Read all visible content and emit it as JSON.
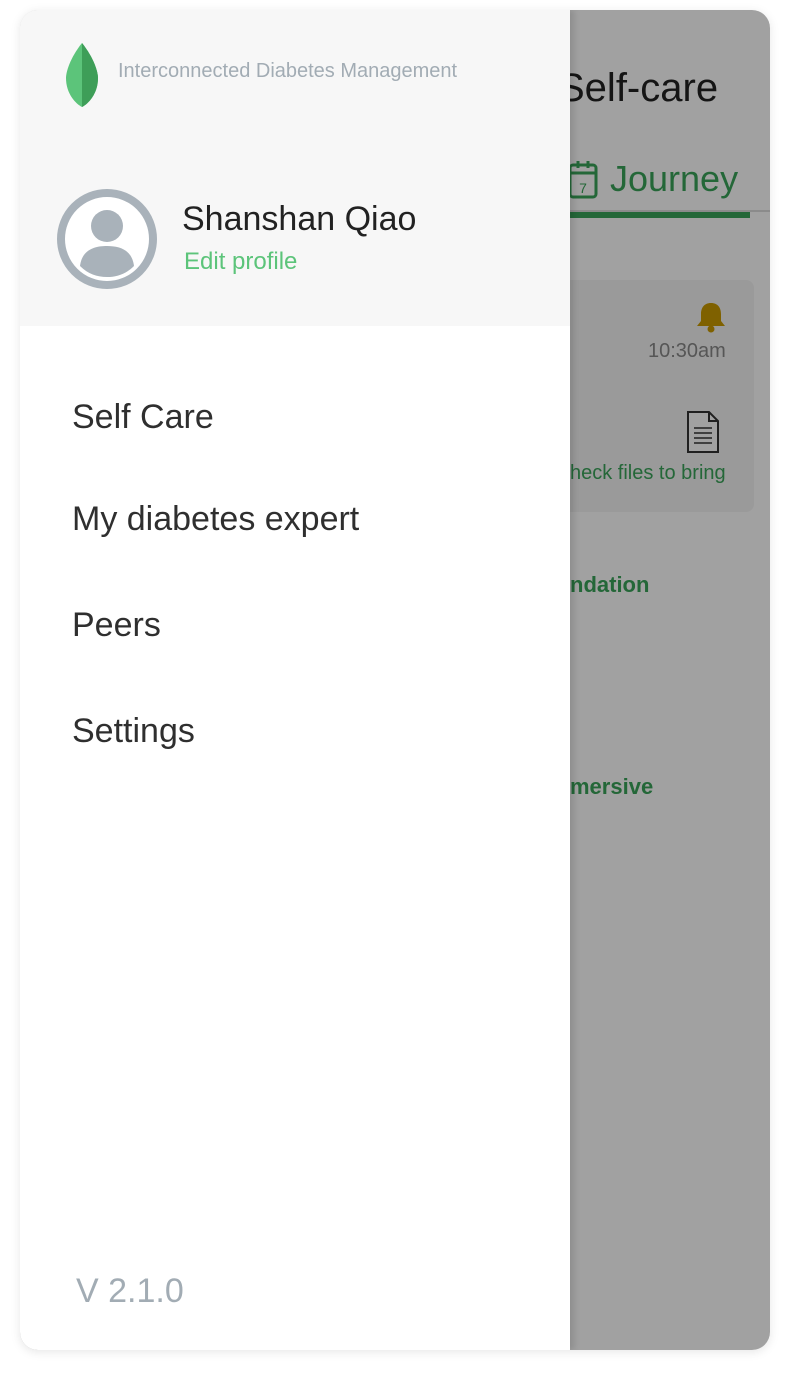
{
  "background": {
    "title": "Self-care",
    "active_tab": "Journey",
    "reminder_time": "10:30am",
    "files_link": "heck files to bring",
    "link_1": "ndation",
    "link_2": "mersive",
    "icons": [
      "calendar-icon",
      "bell-icon",
      "document-icon"
    ],
    "colors": {
      "accent": "#3aa35a",
      "bell": "#c99a00"
    }
  },
  "drawer": {
    "app_name": "Interconnected Diabetes Management",
    "logo_icon": "leaf-icon",
    "user": {
      "name": "Shanshan Qiao",
      "edit_label": "Edit profile",
      "avatar_icon": "user-avatar-icon"
    },
    "menu": [
      {
        "label": "Self Care"
      },
      {
        "label": "My diabetes expert"
      },
      {
        "label": "Peers"
      },
      {
        "label": "Settings"
      }
    ],
    "version": "V 2.1.0",
    "colors": {
      "header_bg": "#f7f7f7",
      "link": "#5cc47a",
      "muted": "#a2acb4",
      "leaf": "#4caf64"
    }
  }
}
